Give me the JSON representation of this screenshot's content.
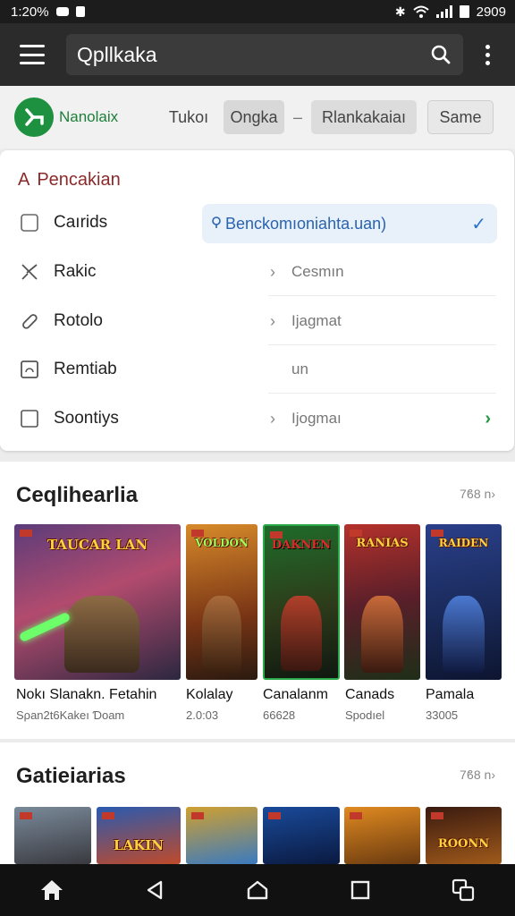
{
  "status_bar": {
    "time": "1:20%",
    "right_text": "2909"
  },
  "app_bar": {
    "search_text": "Qpllkaka"
  },
  "filters": {
    "logo_name": "Nanolaix",
    "chips": [
      "Tukoı",
      "Ongka",
      "–",
      "Rlankakaiaı",
      "Same"
    ]
  },
  "panel": {
    "title": "Pencakian",
    "title_glyph": "A",
    "highlight_text": "Benckomıoniahta.uan)",
    "rows": [
      {
        "label": "Caırids",
        "chev": "",
        "value": ""
      },
      {
        "label": "Rakic",
        "chev": "›",
        "value": "Cesmın"
      },
      {
        "label": "Rotolo",
        "chev": "›",
        "value": "Ijagmat"
      },
      {
        "label": "Remtiab",
        "chev": "",
        "value": "un"
      },
      {
        "label": "Soontiys",
        "chev": "›",
        "value": "Ijogmaı"
      }
    ]
  },
  "section1": {
    "title": "Ceqlihearlia",
    "more": "7ϐ8 n›",
    "games": [
      {
        "poster": "TAUCAR LAN",
        "title": "Nokı Slanakn. Fetahin",
        "sub": "Sρan2t6Kakeı Ɗoam"
      },
      {
        "poster": "VOLDON",
        "title": "Kolalay",
        "sub": "2.0:03"
      },
      {
        "poster": "DAKNEN",
        "title": "Canalanm",
        "sub": "66628"
      },
      {
        "poster": "RANIAS",
        "title": "Canads",
        "sub": "Spodıel"
      },
      {
        "poster": "RAIDEN",
        "title": "Pamala",
        "sub": "33005"
      }
    ]
  },
  "section2": {
    "title": "Gatieiarias",
    "more": "7ϐ8 n›",
    "games": [
      {
        "poster": ""
      },
      {
        "poster": "LAKIN"
      },
      {
        "poster": ""
      },
      {
        "poster": ""
      },
      {
        "poster": ""
      },
      {
        "poster": "ROONN"
      }
    ]
  }
}
